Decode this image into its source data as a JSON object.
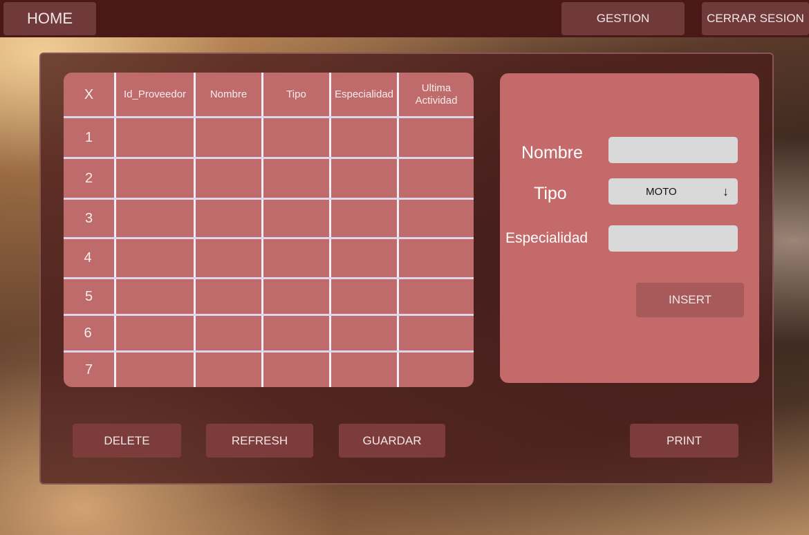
{
  "topbar": {
    "home_label": "HOME",
    "gestion_label": "GESTION",
    "logout_label": "CERRAR SESION"
  },
  "table": {
    "columns": [
      "X",
      "Id_Proveedor",
      "Nombre",
      "Tipo",
      "Especialidad",
      "Ultima Actividad"
    ],
    "rows": [
      "1",
      "2",
      "3",
      "4",
      "5",
      "6",
      "7"
    ]
  },
  "form": {
    "nombre_label": "Nombre",
    "nombre_value": "",
    "tipo_label": "Tipo",
    "tipo_value": "MOTO",
    "especialidad_label": "Especialidad",
    "especialidad_value": "",
    "insert_label": "INSERT"
  },
  "actions": {
    "delete_label": "DELETE",
    "refresh_label": "REFRESH",
    "guardar_label": "GUARDAR",
    "print_label": "PRINT"
  },
  "icons": {
    "dropdown": "arrow-down-icon"
  }
}
